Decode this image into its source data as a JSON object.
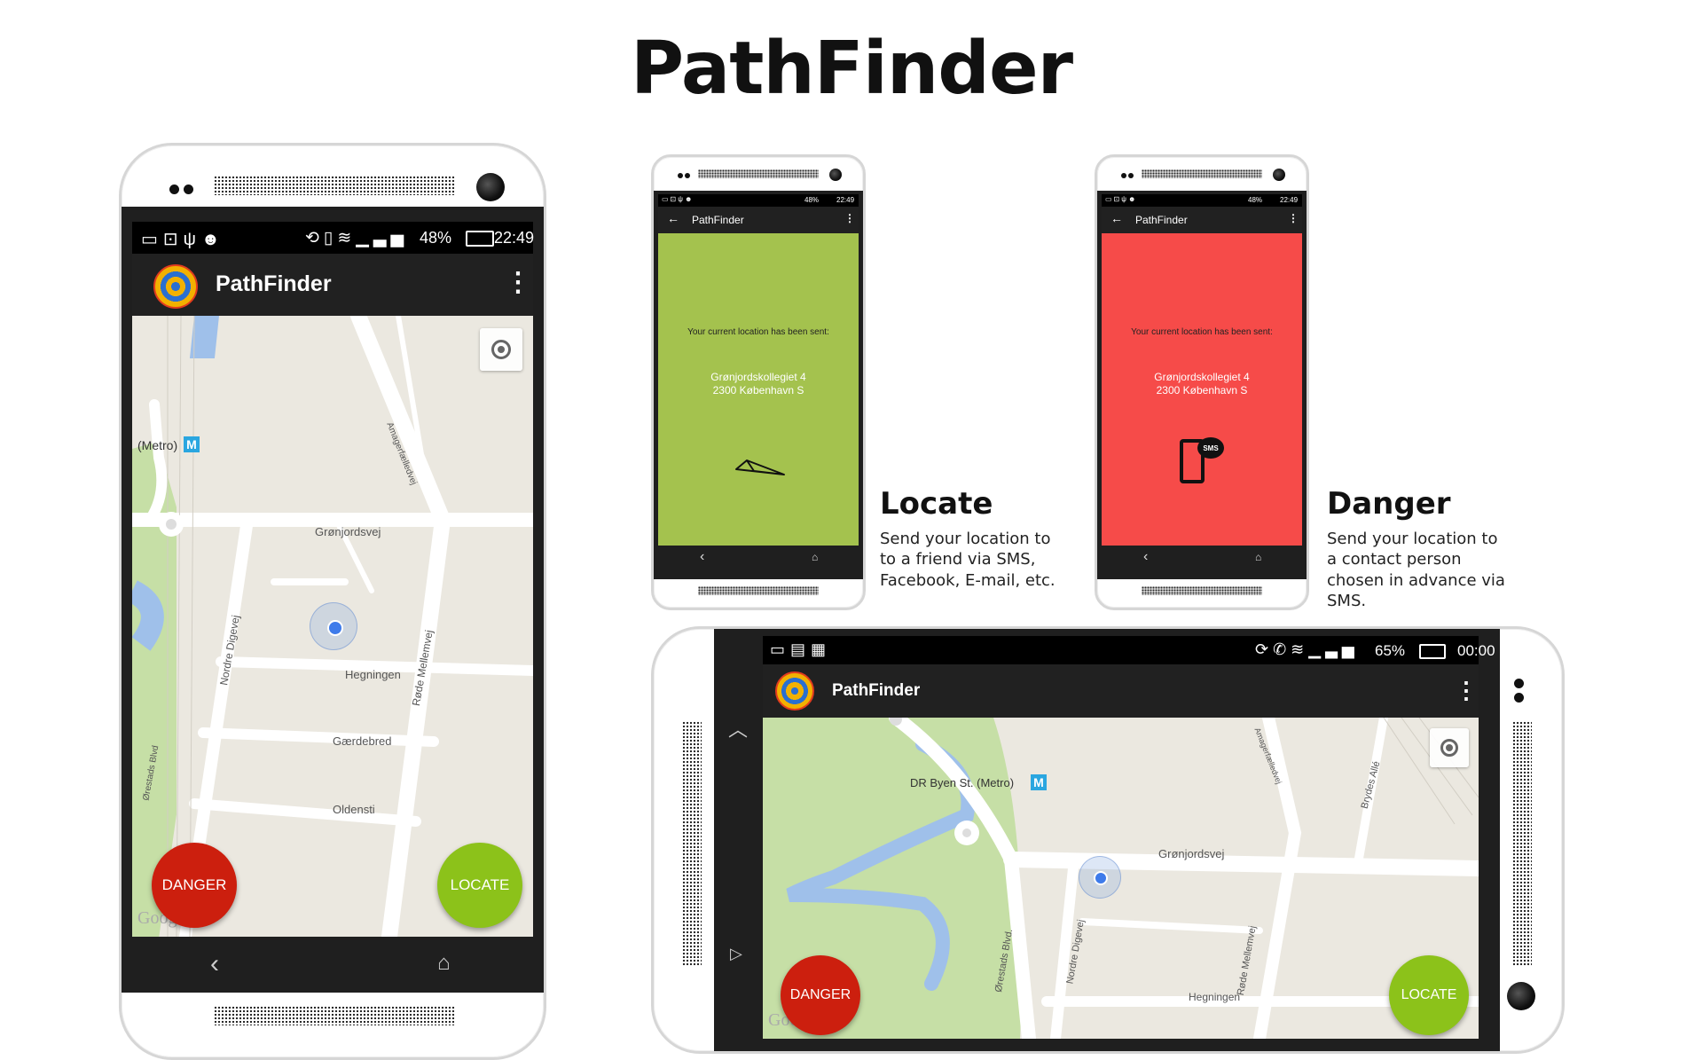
{
  "page_title": "PathFinder",
  "colors": {
    "danger": "#cc1f0e",
    "locate": "#8cc21a",
    "locate_screen": "#a4c24e",
    "danger_screen": "#f64b49",
    "appbar": "#212121",
    "map_bg": "#ebe8e0",
    "park": "#c6dfa6",
    "water": "#9fc0ea"
  },
  "main_phone": {
    "status": {
      "battery_pct": "48%",
      "time": "22:49"
    },
    "app_title": "PathFinder",
    "danger_label": "DANGER",
    "locate_label": "LOCATE",
    "map_labels": {
      "metro": "(Metro)",
      "metro_badge": "M",
      "gronjordsvej": "Grønjordsvej",
      "hegningen": "Hegningen",
      "gaerdebred": "Gærdebred",
      "oldensti": "Oldensti",
      "nordre_digevej": "Nordre Digevej",
      "rode_mellemvej": "Røde Mellemvej",
      "amagerfaelledvej": "Amagerfælledvej",
      "orestads_blvd": "Ørestads Blvd",
      "google": "Goog"
    }
  },
  "locate_phone": {
    "status": {
      "battery_pct": "48%",
      "time": "22:49"
    },
    "app_title": "PathFinder",
    "message": "Your current location has been sent:",
    "address_line1": "Grønjordskollegiet 4",
    "address_line2": "2300 København S",
    "icon": "paper-plane-icon"
  },
  "danger_phone": {
    "status": {
      "battery_pct": "48%",
      "time": "22:49"
    },
    "app_title": "PathFinder",
    "message": "Your current location has been sent:",
    "address_line1": "Grønjordskollegiet 4",
    "address_line2": "2300 København S",
    "icon": "sms-phone-icon",
    "sms_badge": "SMS"
  },
  "locate_desc": {
    "title": "Locate",
    "lines": [
      "Send your location to",
      "to a friend via SMS,",
      "Facebook, E-mail, etc."
    ]
  },
  "danger_desc": {
    "title": "Danger",
    "lines": [
      "Send your location to",
      "a contact person",
      "chosen in advance via",
      "SMS."
    ]
  },
  "landscape_phone": {
    "status": {
      "battery_pct": "65%",
      "time": "00:00"
    },
    "app_title": "PathFinder",
    "danger_label": "DANGER",
    "locate_label": "LOCATE",
    "map_labels": {
      "metro": "DR Byen St. (Metro)",
      "metro_badge": "M",
      "gronjordsvej": "Grønjordsvej",
      "hegningen": "Hegningen",
      "nordre_digevej": "Nordre Digevej",
      "rode_mellemvej": "Røde Mellemvej",
      "orestads_blvd": "Ørestads Blvd.",
      "amagerfaelledvej": "Amagerfælledvej",
      "brydes_alle": "Brydes Allé",
      "google": "Goog"
    }
  }
}
